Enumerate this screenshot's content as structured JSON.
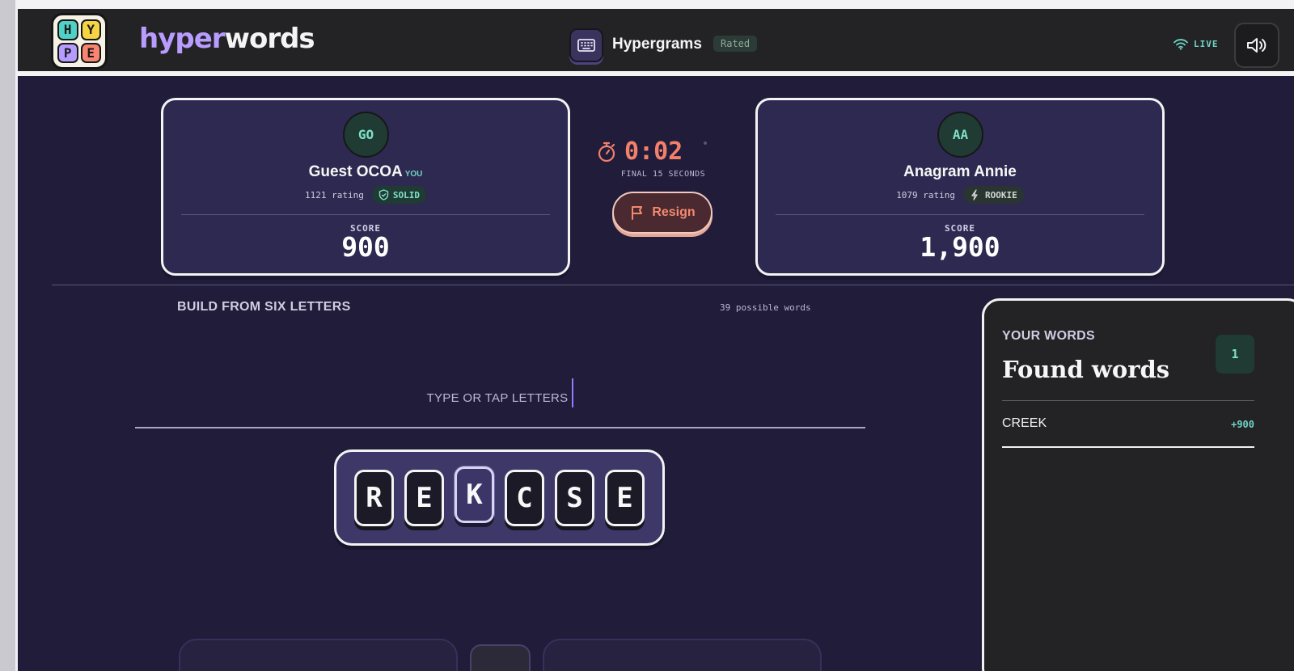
{
  "logo": {
    "letters": [
      "H",
      "Y",
      "P",
      "E"
    ],
    "colors": [
      "#4fd1c5",
      "#f6d443",
      "#b69cff",
      "#f9846f"
    ]
  },
  "brand": {
    "part1": "hyper",
    "part2": "words"
  },
  "header": {
    "mode_icon": "keyboard-icon",
    "mode_title": "Hypergrams",
    "rated_label": "Rated",
    "live_label": "LIVE",
    "sound_icon": "speaker-icon"
  },
  "players": [
    {
      "initials": "GO",
      "name": "Guest OCOA",
      "you_tag": "YOU",
      "rating": "1121 rating",
      "tier": "SOLID",
      "tier_icon": "shield-check-icon",
      "score_label": "SCORE",
      "score": "900"
    },
    {
      "initials": "AA",
      "name": "Anagram Annie",
      "rating": "1079 rating",
      "tier": "ROOKIE",
      "tier_icon": "sparkle-icon",
      "score_label": "SCORE",
      "score": "1,900"
    }
  ],
  "timer": {
    "value": "0:02",
    "caption": "FINAL 15 SECONDS"
  },
  "resign": {
    "label": "Resign"
  },
  "puzzle": {
    "heading": "BUILD FROM SIX LETTERS",
    "possible": "39 possible words",
    "placeholder": "TYPE OR TAP LETTERS"
  },
  "tiles": [
    "R",
    "E",
    "K",
    "C",
    "S",
    "E"
  ],
  "selected_tile_index": 2,
  "found": {
    "kicker": "YOUR WORDS",
    "title": "Found words",
    "count": "1",
    "words": [
      {
        "word": "CREEK",
        "points": "+900"
      }
    ]
  },
  "colors": {
    "accent": "#b89cff",
    "teal": "#6fd3c4",
    "timer": "#f2806a",
    "background": "#201c3a"
  }
}
